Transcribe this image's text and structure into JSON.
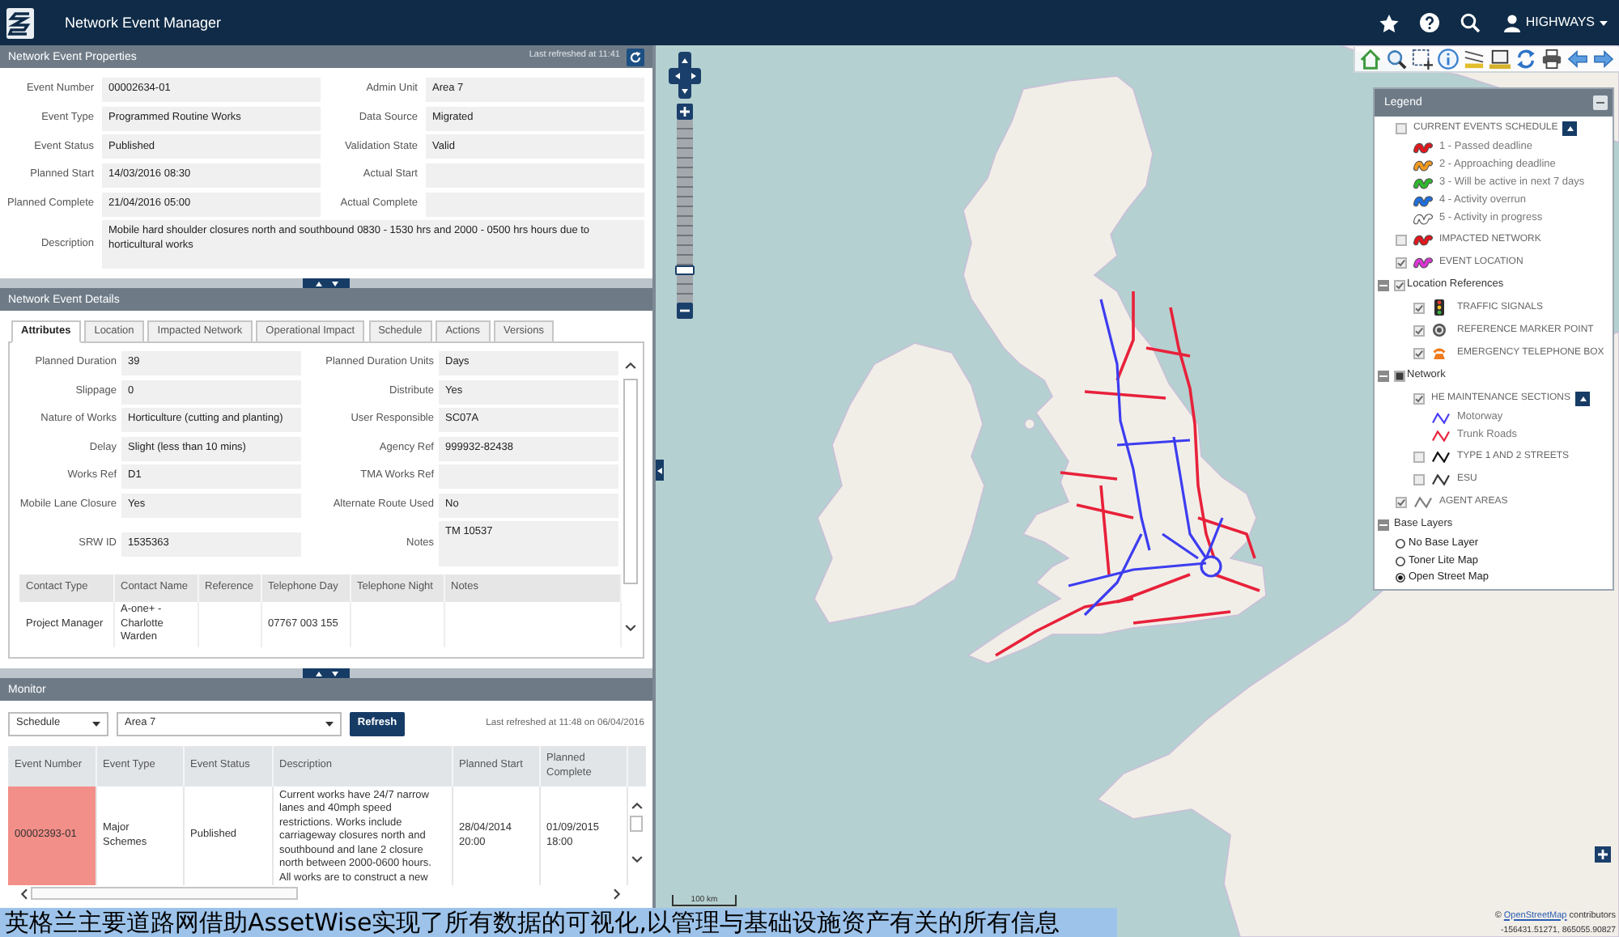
{
  "app_bar": {
    "title": "Network Event Manager",
    "user": "HIGHWAYS"
  },
  "properties_panel": {
    "title": "Network Event Properties",
    "refreshed": "Last refreshed at 11:41",
    "fields": [
      {
        "label": "Event Number",
        "value": "00002634-01"
      },
      {
        "label": "Admin Unit",
        "value": "Area 7"
      },
      {
        "label": "Event Type",
        "value": "Programmed Routine Works"
      },
      {
        "label": "Data Source",
        "value": "Migrated"
      },
      {
        "label": "Event Status",
        "value": "Published"
      },
      {
        "label": "Validation State",
        "value": "Valid"
      },
      {
        "label": "Planned Start",
        "value": "14/03/2016 08:30"
      },
      {
        "label": "Actual Start"
      },
      {
        "label": "Planned Complete",
        "value": "21/04/2016 05:00"
      },
      {
        "label": "Actual Complete"
      }
    ],
    "description": {
      "label": "Description",
      "value": "Mobile hard shoulder closures north and southbound 0830 - 1530 hrs and 2000 - 0500 hrs hours due to horticultural works"
    }
  },
  "details_panel": {
    "title": "Network Event Details",
    "tabs": [
      {
        "label": "Attributes",
        "selected": true
      },
      {
        "label": "Location",
        "selected": false
      },
      {
        "label": "Impacted Network",
        "selected": false
      },
      {
        "label": "Operational Impact",
        "selected": false
      },
      {
        "label": "Schedule",
        "selected": false
      },
      {
        "label": "Actions",
        "selected": false
      },
      {
        "label": "Versions",
        "selected": false
      }
    ],
    "fields": [
      {
        "kind": "line",
        "label": "Planned Duration",
        "value": "39"
      },
      {
        "kind": "line",
        "label": "Planned Duration Units",
        "value": "Days"
      },
      {
        "kind": "line",
        "label": "Slippage",
        "value": "0"
      },
      {
        "kind": "line",
        "label": "Distribute",
        "value": "Yes"
      },
      {
        "kind": "line",
        "label": "Nature of Works",
        "value": "Horticulture (cutting and planting)"
      },
      {
        "kind": "line",
        "label": "User Responsible",
        "value": "SC07A"
      },
      {
        "kind": "line",
        "label": "Delay",
        "value": "Slight (less than 10 mins)"
      },
      {
        "kind": "line",
        "label": "Agency Ref",
        "value": "999932-82438"
      },
      {
        "kind": "line",
        "label": "Works Ref",
        "value": "D1"
      },
      {
        "kind": "line",
        "label": "TMA Works Ref"
      },
      {
        "kind": "line",
        "label": "Mobile Lane Closure",
        "value": "Yes"
      },
      {
        "kind": "line",
        "label": "Alternate Route Used",
        "value": "No"
      },
      {
        "kind": "line",
        "label": "SRW ID",
        "value": "1535363"
      },
      {
        "kind": "area",
        "label": "Notes",
        "value": "TM 10537"
      }
    ],
    "contacts": {
      "columns": [
        "Contact Type",
        "Contact Name",
        "Reference",
        "Telephone Day",
        "Telephone Night",
        "Notes"
      ],
      "rows": [
        {
          "cells": [
            "Project Manager",
            "A-one+ - Charlotte Warden",
            null,
            "07767 003 155",
            null,
            null
          ]
        }
      ]
    }
  },
  "monitor_panel": {
    "title": "Monitor",
    "view": "Schedule",
    "area": "Area 7",
    "refresh_button": "Refresh",
    "refreshed": "Last refreshed at 11:48 on 06/04/2016",
    "columns": [
      "Event Number",
      "Event Type",
      "Event Status",
      "Description",
      "Planned Start",
      "Planned Complete"
    ],
    "rows": [
      {
        "color": "#f28f88",
        "cells": [
          "00002393-01",
          "Major Schemes",
          "Published",
          "Current works have 24/7 narrow lanes and 40mph speed restrictions. Works include carriageway closures north and southbound and lane 2 closure north between 2000-0600 hours. All works are to construct a new",
          "28/04/2014 20:00",
          "01/09/2015 18:00"
        ]
      }
    ]
  },
  "map": {
    "zoom_slider": {
      "level": 0.18
    },
    "scale": "100 km",
    "attribution": {
      "prefix": "©",
      "link": "OpenStreetMap",
      "suffix": "contributors"
    },
    "coordinates": "-156431.51271, 865055.90827"
  },
  "legend": {
    "title": "Legend",
    "expanded": true,
    "items": [
      {
        "kind": "layer",
        "label": "CURRENT EVENTS SCHEDULE",
        "checked": false,
        "expanded": true,
        "children": [
          {
            "kind": "key",
            "label": "1 - Passed deadline",
            "symbol": {
              "kind": "squiggle",
              "color": "#e3161d"
            }
          },
          {
            "kind": "key",
            "label": "2 - Approaching deadline",
            "symbol": {
              "kind": "squiggle",
              "color": "#f39a1f"
            }
          },
          {
            "kind": "key",
            "label": "3 - Will be active in next 7 days",
            "symbol": {
              "kind": "squiggle",
              "color": "#2eb82e"
            }
          },
          {
            "kind": "key",
            "label": "4 - Activity overrun",
            "symbol": {
              "kind": "squiggle",
              "color": "#1f6fe0"
            }
          },
          {
            "kind": "key",
            "label": "5 - Activity in progress",
            "symbol": {
              "kind": "hollow_squiggle"
            }
          }
        ]
      },
      {
        "kind": "layer",
        "label": "IMPACTED NETWORK",
        "checked": false,
        "symbol": {
          "kind": "squiggle",
          "color": "#e3161d"
        }
      },
      {
        "kind": "layer",
        "label": "EVENT LOCATION",
        "checked": true,
        "symbol": {
          "kind": "squiggle",
          "color": "#d936d4"
        }
      },
      {
        "kind": "group",
        "label": "Location References",
        "expanded": true,
        "checked": true,
        "indeterminate": false,
        "children": [
          {
            "kind": "layer",
            "label": "TRAFFIC SIGNALS",
            "checked": true,
            "symbol": {
              "kind": "traffic_light"
            }
          },
          {
            "kind": "layer",
            "label": "REFERENCE MARKER POINT",
            "checked": true,
            "symbol": {
              "kind": "target"
            }
          },
          {
            "kind": "layer",
            "label": "EMERGENCY TELEPHONE BOX",
            "checked": true,
            "symbol": {
              "kind": "telephone"
            }
          }
        ]
      },
      {
        "kind": "group",
        "label": "Network",
        "expanded": true,
        "checked": false,
        "indeterminate": true,
        "children": [
          {
            "kind": "layer",
            "label": "HE MAINTENANCE SECTIONS",
            "checked": true,
            "expanded": true,
            "children": [
              {
                "kind": "key",
                "label": "Motorway",
                "symbol": {
                  "kind": "zigzag",
                  "color": "#4b3ff2"
                }
              },
              {
                "kind": "key",
                "label": "Trunk Roads",
                "symbol": {
                  "kind": "zigzag",
                  "color": "#e8263f"
                }
              }
            ]
          },
          {
            "kind": "layer",
            "label": "TYPE 1 AND 2 STREETS",
            "checked": false,
            "symbol": {
              "kind": "zigzag",
              "color": "#111111"
            }
          },
          {
            "kind": "layer",
            "label": "ESU",
            "checked": false,
            "symbol": {
              "kind": "zigzag",
              "color": "#3a3a3a"
            }
          }
        ]
      },
      {
        "kind": "layer",
        "label": "AGENT AREAS",
        "checked": true,
        "symbol": {
          "kind": "zigzag",
          "color": "#808080"
        }
      },
      {
        "kind": "group",
        "label": "Base Layers",
        "expanded": true,
        "children": [
          {
            "kind": "radio",
            "label": "No Base Layer",
            "selected": false
          },
          {
            "kind": "radio",
            "label": "Toner Lite Map",
            "selected": false
          },
          {
            "kind": "radio",
            "label": "Open Street Map",
            "selected": true
          }
        ]
      }
    ]
  },
  "caption": "英格兰主要道路网借助AssetWise实现了所有数据的可视化,以管理与基础设施资产有关的所有信息"
}
